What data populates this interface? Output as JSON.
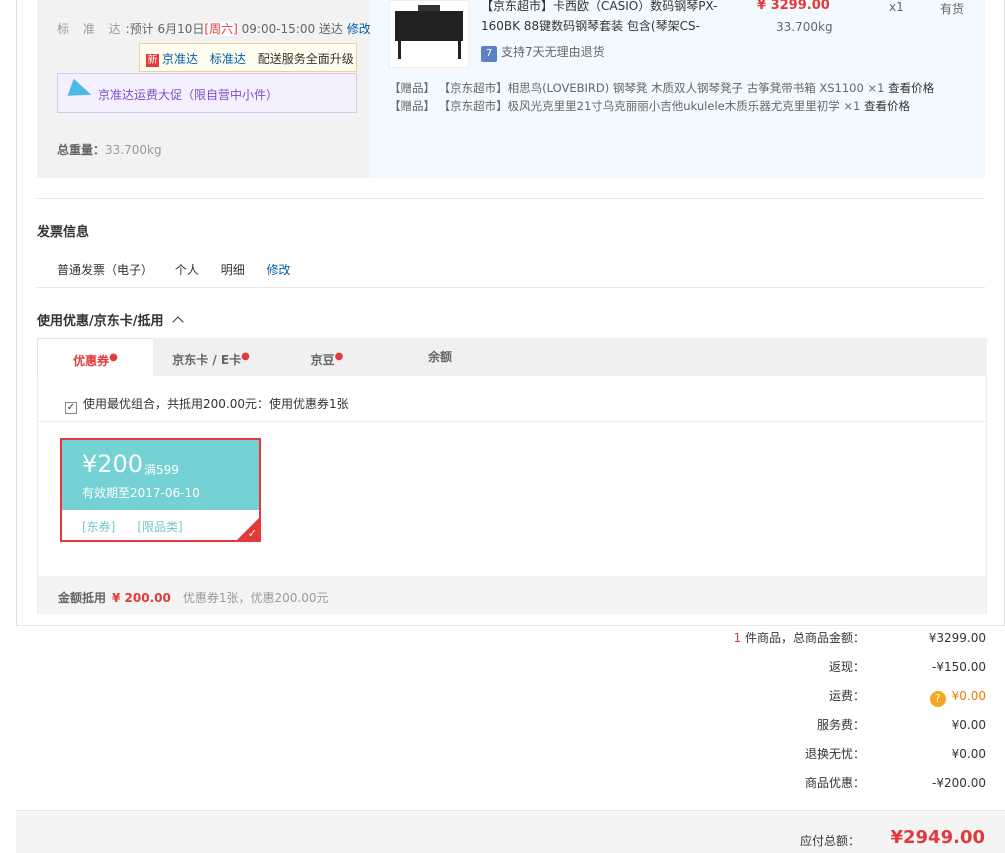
{
  "shipping": {
    "date_label": "标 准 达",
    "date_prefix": "预计 6月10日",
    "weekday": "[周六]",
    "time": "09:00-15:00 送达",
    "edit_link": "修改",
    "tip_new_badge": "新",
    "tip_brand": "京准达",
    "tip_standard": "标准达",
    "tip_text": "配送服务全面升级",
    "promo_text": "京准达运费大促（限自营中小件）",
    "weight_label": "总重量：",
    "weight_value": "33.700kg"
  },
  "goods": {
    "name": "【京东超市】卡西欧（CASIO）数码钢琴PX-160BK 88键数码钢琴套装 包含(琴架CS-",
    "price": "¥ 3299.00",
    "weight": "33.700kg",
    "qty": "x1",
    "stock": "有货",
    "support_icon": "7",
    "support_text": "支持7天无理由退货",
    "gifts": [
      {
        "tag": "【赠品】",
        "name": "【京东超市】相思鸟(LOVEBIRD) 钢琴凳 木质双人钢琴凳子 古筝凳带书箱 XS1100",
        "qty": "×1",
        "link": "查看价格"
      },
      {
        "tag": "【赠品】",
        "name": "【京东超市】极风光克里里21寸乌克丽丽小吉他ukulele木质乐器尤克里里初学",
        "qty": "×1",
        "link": "查看价格"
      }
    ]
  },
  "invoice": {
    "title": "发票信息",
    "type": "普通发票（电子）",
    "person": "个人",
    "detail": "明细",
    "edit": "修改"
  },
  "discount": {
    "title": "使用优惠/京东卡/抵用",
    "tabs": [
      {
        "label": "优惠券",
        "dot": "●"
      },
      {
        "label": "京东卡 / E卡",
        "dot": "●"
      },
      {
        "label": "京豆",
        "dot": "●"
      },
      {
        "label": "余额",
        "dot": ""
      }
    ],
    "best_combo": "使用最优组合，共抵用200.00元：使用优惠券1张",
    "best_checked": "✓",
    "coupon": {
      "amount": "¥200",
      "condition": "满599",
      "valid": "有效期至2017-06-10",
      "tag1": "[东券]",
      "tag2": "[限品类]",
      "check": "✓"
    },
    "summary_label": "金额抵用",
    "summary_amount": "¥ 200.00",
    "summary_detail": "优惠券1张，优惠200.00元"
  },
  "totals": {
    "items_count": "1",
    "items_label": "件商品，总商品金额：",
    "items_value": "¥3299.00",
    "rebate_label": "返现：",
    "rebate_value": "-¥150.00",
    "freight_label": "运费：",
    "freight_help": "?",
    "freight_value": "¥0.00",
    "service_label": "服务费：",
    "service_value": "¥0.00",
    "exchange_label": "退换无忧：",
    "exchange_value": "¥0.00",
    "discount_label": "商品优惠：",
    "discount_value": "-¥200.00",
    "pay_label": "应付总额：",
    "pay_value": "¥2949.00"
  }
}
